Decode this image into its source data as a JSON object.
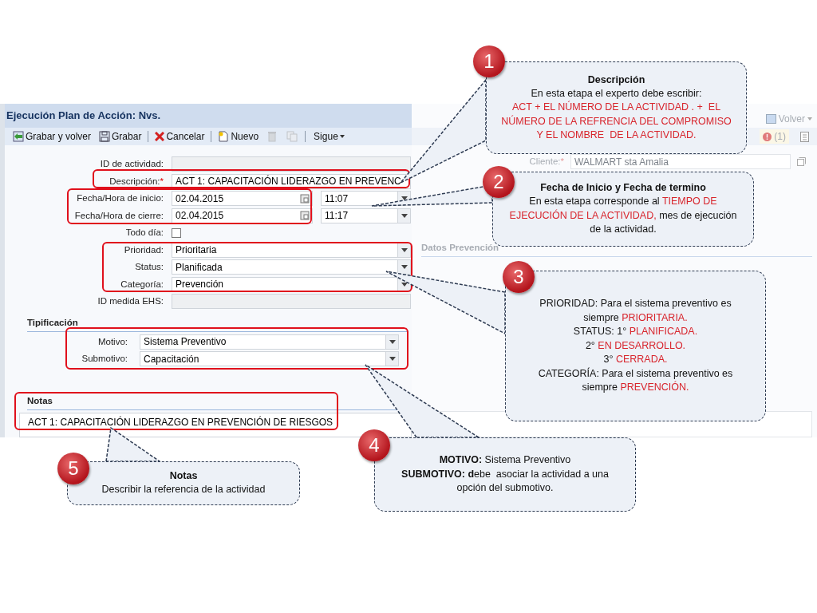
{
  "form": {
    "title": "Ejecución Plan de Acción: Nvs.",
    "toolbar": [
      {
        "kind": "button",
        "label": "Grabar y volver"
      },
      {
        "kind": "button",
        "label": "Grabar"
      },
      {
        "kind": "separator"
      },
      {
        "kind": "button",
        "label": "Cancelar"
      },
      {
        "kind": "separator"
      },
      {
        "kind": "button",
        "label": "Nuevo"
      },
      {
        "kind": "icon-button",
        "disabled": true
      },
      {
        "kind": "icon-button",
        "disabled": true
      },
      {
        "kind": "separator"
      },
      {
        "kind": "menu",
        "label": "Sigue"
      }
    ],
    "fields": [
      {
        "kind": "text",
        "label": "ID de actividad:",
        "disabled": true
      },
      {
        "kind": "text",
        "label": "Descripción:",
        "required_mark": "*",
        "value": "ACT 1: CAPACITACIÓN LIDERAZGO EN PREVENC",
        "disabled": false
      },
      {
        "kind": "datetime",
        "label": "Fecha/Hora de inicio:",
        "date": "02.04.2015",
        "time": "11:07"
      },
      {
        "kind": "datetime",
        "label": "Fecha/Hora de cierre:",
        "date": "02.04.2015",
        "time": "11:17"
      },
      {
        "kind": "checkbox",
        "label": "Todo día:",
        "checked": false
      },
      {
        "kind": "select",
        "label": "Prioridad:",
        "value": "Prioritaria"
      },
      {
        "kind": "select",
        "label": "Status:",
        "value": "Planificada"
      },
      {
        "kind": "select",
        "label": "Categoría:",
        "value": "Prevención"
      },
      {
        "kind": "text",
        "label": "ID medida EHS:",
        "disabled": true
      }
    ],
    "typification": {
      "title": "Tipificación",
      "fields": [
        {
          "kind": "select",
          "label": "Motivo:",
          "value": "Sistema Preventivo"
        },
        {
          "kind": "select",
          "label": "Submotivo:",
          "value": "Capacitación"
        }
      ]
    },
    "notes": {
      "title": "Notas",
      "value": "ACT 1: CAPACITACIÓN LIDERAZGO EN PREVENCIÓN DE RIESGOS"
    }
  },
  "side_panel": {
    "back_button": "Volver",
    "alerts": "(1)",
    "client": {
      "label": "Cliente:",
      "required_mark": "*",
      "value": "WALMART sta Amalia"
    },
    "section": "Datos Prevención"
  },
  "callouts": [
    {
      "number": "1",
      "title": "Descripción",
      "lines": [
        [
          {
            "kind": "normal",
            "text": "En esta etapa el experto debe escribir:"
          }
        ],
        [
          {
            "kind": "emphasis",
            "text": "ACT + EL NÚMERO DE LA ACTIVIDAD . +  EL"
          }
        ],
        [
          {
            "kind": "emphasis",
            "text": "NÚMERO DE LA REFRENCIA DEL COMPROMISO"
          }
        ],
        [
          {
            "kind": "emphasis",
            "text": "Y EL NOMBRE  DE LA ACTIVIDAD."
          }
        ]
      ]
    },
    {
      "number": "2",
      "title": "Fecha de Inicio y Fecha de termino",
      "lines": [
        [
          {
            "kind": "normal",
            "text": "En esta etapa corresponde al "
          },
          {
            "kind": "emphasis",
            "text": "TIEMPO DE"
          }
        ],
        [
          {
            "kind": "emphasis",
            "text": "EJECUCIÓN DE LA ACTIVIDAD,"
          },
          {
            "kind": "normal",
            "text": " mes de ejecución"
          }
        ],
        [
          {
            "kind": "normal",
            "text": "de la actividad."
          }
        ]
      ]
    },
    {
      "number": "3",
      "lines": [
        [
          {
            "kind": "normal",
            "text": "PRIORIDAD: Para el sistema preventivo es"
          }
        ],
        [
          {
            "kind": "normal",
            "text": "siempre "
          },
          {
            "kind": "emphasis",
            "text": "PRIORITARIA."
          }
        ],
        [
          {
            "kind": "normal",
            "text": "STATUS: 1° "
          },
          {
            "kind": "emphasis",
            "text": "PLANIFICADA."
          }
        ],
        [
          {
            "kind": "normal",
            "text": "2° "
          },
          {
            "kind": "emphasis",
            "text": "EN DESARROLLO."
          }
        ],
        [
          {
            "kind": "normal",
            "text": "3° "
          },
          {
            "kind": "emphasis",
            "text": "CERRADA."
          }
        ],
        [
          {
            "kind": "normal",
            "text": "CATEGORÍA: Para el sistema preventivo es"
          }
        ],
        [
          {
            "kind": "normal",
            "text": "siempre "
          },
          {
            "kind": "emphasis",
            "text": "PREVENCIÓN."
          }
        ]
      ]
    },
    {
      "number": "5",
      "title": "Notas",
      "lines": [
        [
          {
            "kind": "normal",
            "text": "Describir la referencia de la actividad"
          }
        ]
      ]
    },
    {
      "number": "4",
      "lines": [
        [
          {
            "kind": "strong",
            "text": "MOTIVO:"
          },
          {
            "kind": "normal",
            "text": " Sistema Preventivo"
          }
        ],
        [
          {
            "kind": "strong",
            "text": "SUBMOTIVO: d"
          },
          {
            "kind": "normal",
            "text": "ebe  asociar la actividad a una"
          }
        ],
        [
          {
            "kind": "normal",
            "text": "opción del submotivo."
          }
        ]
      ]
    }
  ]
}
